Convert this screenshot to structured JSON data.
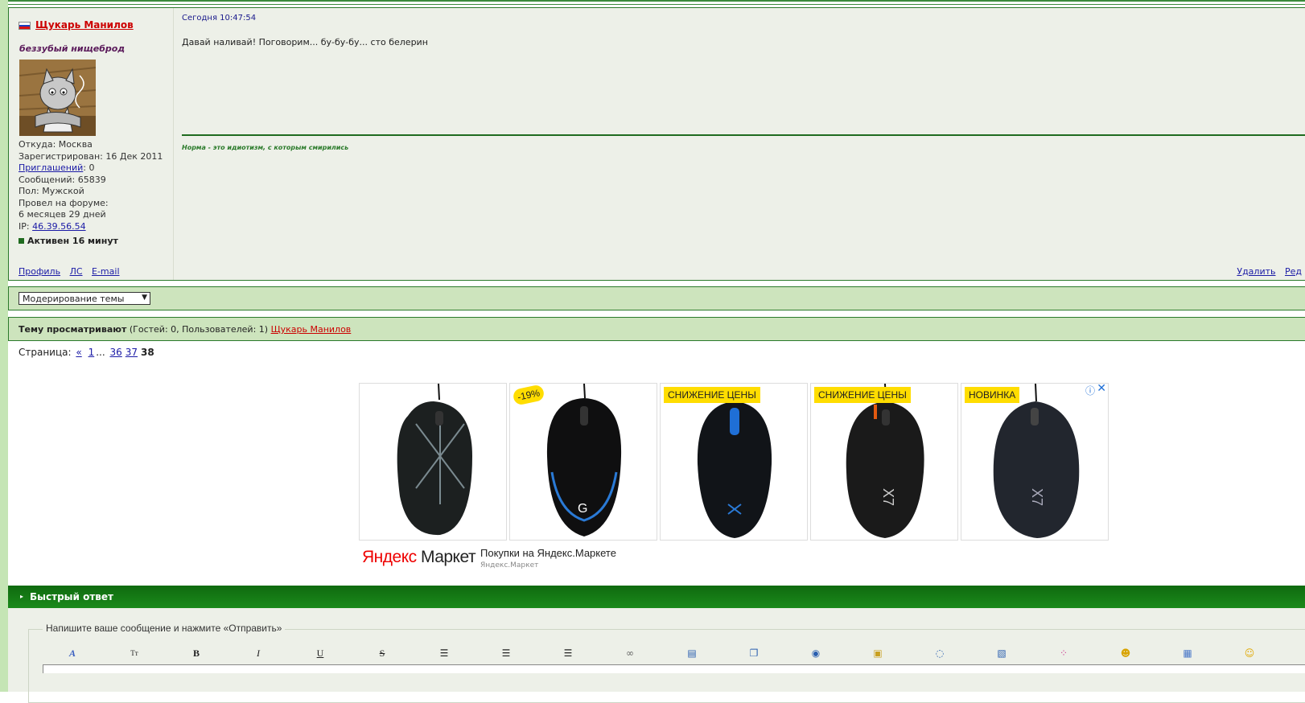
{
  "post": {
    "username": "Щукарь Манилов",
    "user_title": "беззубый нищеброд",
    "info": {
      "from_label": "Откуда:",
      "from": "Москва",
      "registered_label": "Зарегистрирован:",
      "registered": "16 Дек 2011",
      "invites_label": "Приглашений",
      "invites": ": 0",
      "messages_label": "Сообщений:",
      "messages": "65839",
      "gender_label": "Пол:",
      "gender": "Мужской",
      "forum_time_label": "Провел на форуме:",
      "forum_time": "6 месяцев 29 дней",
      "ip_label": "IP:",
      "ip": "46.39.56.54"
    },
    "active": "Активен 16 минут",
    "links": {
      "profile": "Профиль",
      "pm": "ЛС",
      "email": "E-mail"
    },
    "actions": {
      "delete": "Удалить",
      "edit": "Ред"
    },
    "date": "Сегодня 10:47:54",
    "text": "Давай наливай! Поговорим... бу-бу-бу... сто белерин",
    "signature": "Норма - это идиотизм, с которым смирились"
  },
  "moderation": {
    "select_value": "Модерирование темы"
  },
  "viewers": {
    "label": "Тему просматривают",
    "counts": "(Гостей: 0, Пользователей: 1)",
    "user": "Щукарь Манилов"
  },
  "pagination": {
    "label": "Страница:",
    "prev": "«",
    "first": "1",
    "ellipsis": "...",
    "p36": "36",
    "p37": "37",
    "current": "38"
  },
  "ad": {
    "badges": [
      "-19%",
      "СНИЖЕНИЕ ЦЕНЫ",
      "СНИЖЕНИЕ ЦЕНЫ",
      "НОВИНКА"
    ],
    "logo_part1": "Яндекс",
    "logo_part2": "Маркет",
    "title": "Покупки на Яндекс.Маркете",
    "subtitle": "Яндекс.Маркет",
    "info_icon": "ⓘ",
    "close_icon": "✕"
  },
  "quick_reply": {
    "title": "Быстрый ответ",
    "legend": "Напишите ваше сообщение и нажмите «Отправить»"
  },
  "colors": {
    "accent_green": "#1f6b1f",
    "username_red": "#cc0000",
    "link_blue": "#1a1aa6",
    "ad_badge": "#ffdd00"
  }
}
